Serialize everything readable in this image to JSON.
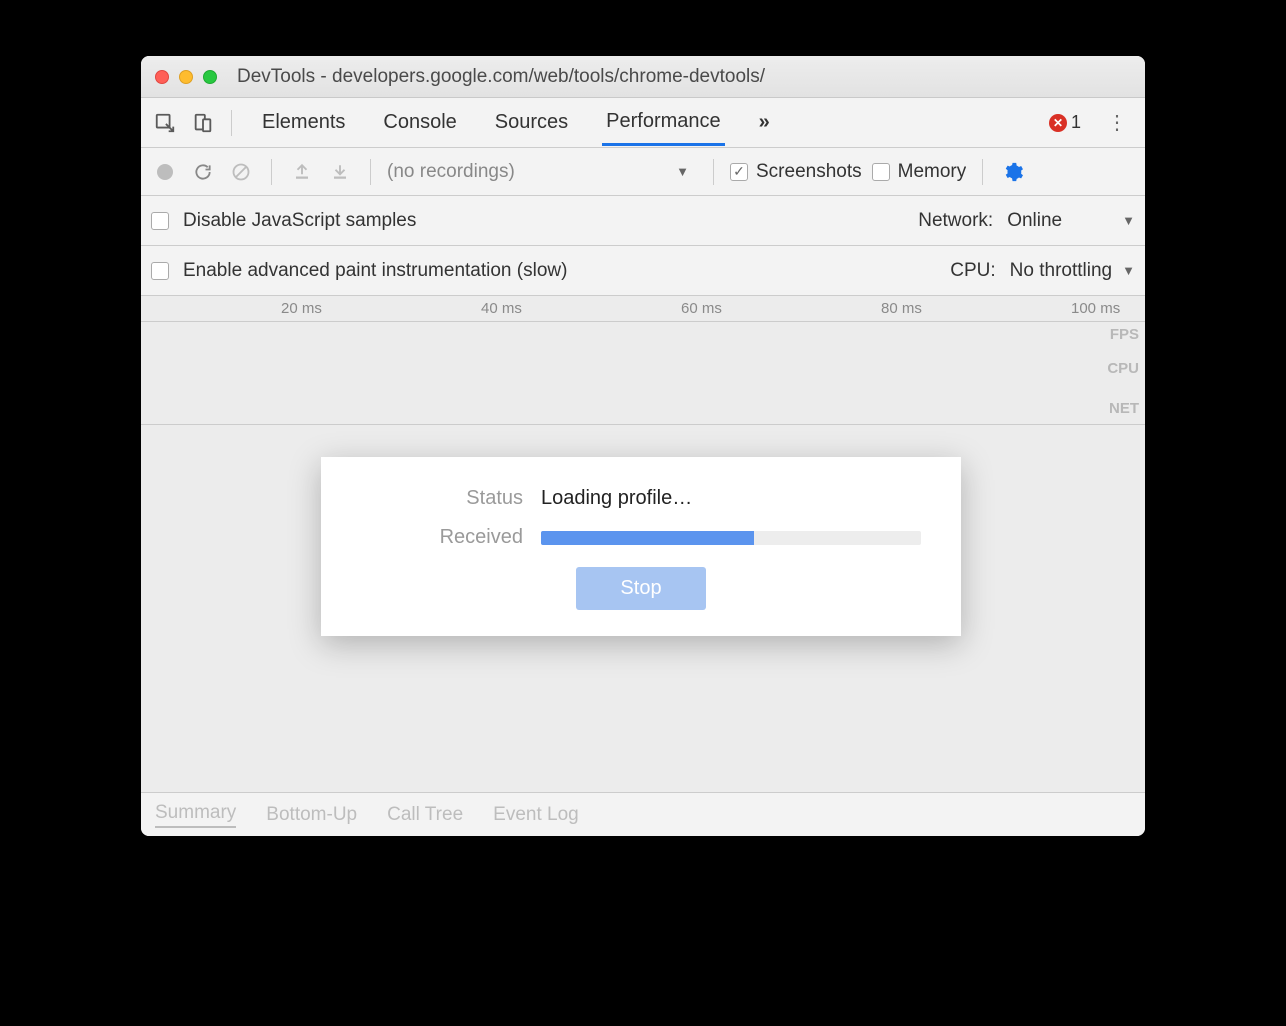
{
  "window": {
    "title": "DevTools - developers.google.com/web/tools/chrome-devtools/"
  },
  "tabs": {
    "items": [
      "Elements",
      "Console",
      "Sources",
      "Performance"
    ],
    "active": "Performance",
    "overflow_glyph": "»",
    "error_count": "1"
  },
  "perf_toolbar": {
    "recordings_label": "(no recordings)",
    "screenshots_label": "Screenshots",
    "screenshots_checked": true,
    "memory_label": "Memory",
    "memory_checked": false
  },
  "options": {
    "row1": {
      "disable_js_label": "Disable JavaScript samples",
      "network_label": "Network:",
      "network_value": "Online"
    },
    "row2": {
      "paint_label": "Enable advanced paint instrumentation (slow)",
      "cpu_label": "CPU:",
      "cpu_value": "No throttling"
    }
  },
  "timeline": {
    "ticks": [
      "20 ms",
      "40 ms",
      "60 ms",
      "80 ms",
      "100 ms"
    ],
    "lanes": [
      "FPS",
      "CPU",
      "NET"
    ]
  },
  "dialog": {
    "status_label": "Status",
    "status_value": "Loading profile…",
    "received_label": "Received",
    "progress_percent": 56,
    "stop_label": "Stop"
  },
  "bottom_tabs": {
    "items": [
      "Summary",
      "Bottom-Up",
      "Call Tree",
      "Event Log"
    ],
    "active": "Summary"
  }
}
